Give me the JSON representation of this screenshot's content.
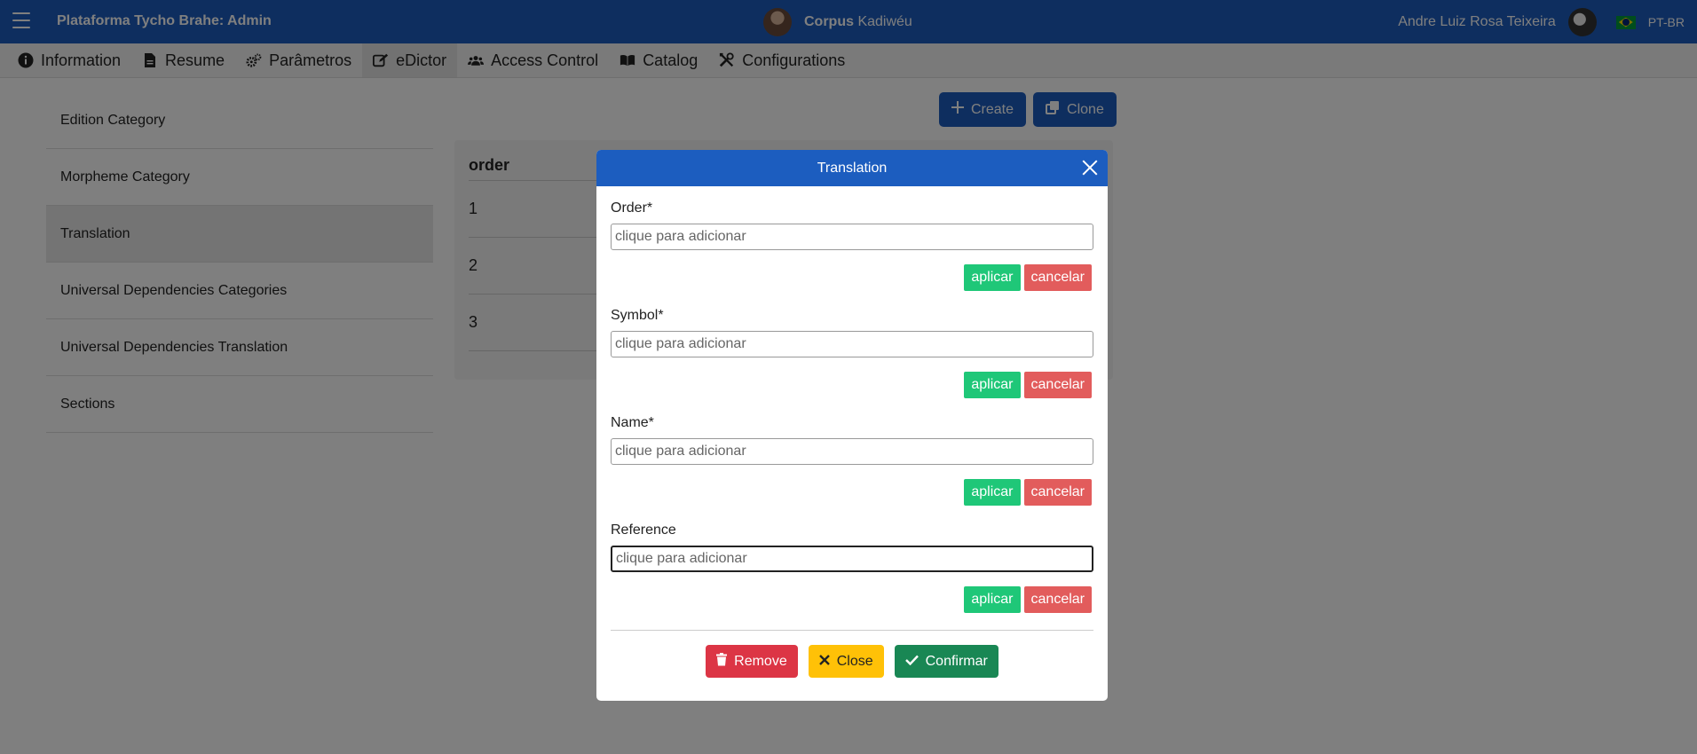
{
  "header": {
    "app_title": "Plataforma Tycho Brahe: Admin",
    "corpus_label": "Corpus",
    "corpus_name": "Kadiwéu",
    "user_name": "Andre Luiz Rosa Teixeira",
    "language": "PT-BR"
  },
  "nav": {
    "tabs": [
      {
        "label": "Information",
        "icon": "info-icon"
      },
      {
        "label": "Resume",
        "icon": "document-icon"
      },
      {
        "label": "Parâmetros",
        "icon": "gears-icon"
      },
      {
        "label": "eDictor",
        "icon": "edit-icon",
        "active": true
      },
      {
        "label": "Access Control",
        "icon": "users-icon"
      },
      {
        "label": "Catalog",
        "icon": "book-icon"
      },
      {
        "label": "Configurations",
        "icon": "tools-icon"
      }
    ]
  },
  "sidebar": {
    "items": [
      {
        "label": "Edition Category"
      },
      {
        "label": "Morpheme Category"
      },
      {
        "label": "Translation",
        "active": true
      },
      {
        "label": "Universal Dependencies Categories"
      },
      {
        "label": "Universal Dependencies Translation"
      },
      {
        "label": "Sections"
      }
    ]
  },
  "toolbar": {
    "create_label": "Create",
    "clone_label": "Clone"
  },
  "table": {
    "header": "order",
    "rows": [
      "1",
      "2",
      "3"
    ]
  },
  "modal": {
    "title": "Translation",
    "fields": [
      {
        "label": "Order*",
        "placeholder": "clique para adicionar"
      },
      {
        "label": "Symbol*",
        "placeholder": "clique para adicionar"
      },
      {
        "label": "Name*",
        "placeholder": "clique para adicionar"
      },
      {
        "label": "Reference",
        "placeholder": "clique para adicionar"
      }
    ],
    "apply_label": "aplicar",
    "cancel_label": "cancelar",
    "remove_label": "Remove",
    "close_label": "Close",
    "confirm_label": "Confirmar"
  },
  "colors": {
    "primary": "#1c5dbf",
    "apply": "#1fc778",
    "cancel": "#e25c5c",
    "remove": "#dc3545",
    "close": "#ffc107",
    "confirm": "#198754"
  }
}
